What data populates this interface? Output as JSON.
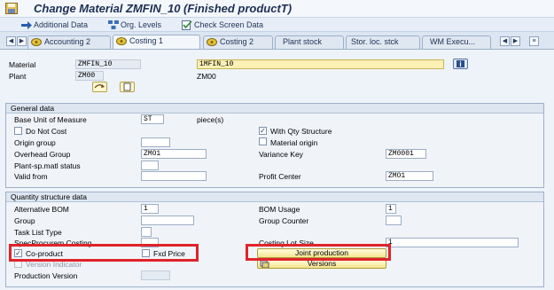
{
  "title": "Change Material ZMFIN_10 (Finished productT)",
  "toolbar": {
    "additional_data": "Additional Data",
    "org_levels": "Org. Levels",
    "check_screen_data": "Check Screen Data"
  },
  "tabs": [
    {
      "label": "Accounting 2"
    },
    {
      "label": "Costing 1"
    },
    {
      "label": "Costing 2"
    },
    {
      "label": "Plant stock"
    },
    {
      "label": "Stor. loc. stck"
    },
    {
      "label": "WM Execu..."
    }
  ],
  "header": {
    "material_label": "Material",
    "material_value": "ZMFIN_10",
    "material_desc": "1MFIN_10",
    "plant_label": "Plant",
    "plant_value": "ZM00",
    "plant_desc": "ZM00"
  },
  "general": {
    "title": "General data",
    "base_uom_label": "Base Unit of Measure",
    "base_uom_value": "ST",
    "base_uom_text": "piece(s)",
    "do_not_cost_label": "Do Not Cost",
    "with_qty_structure_label": "With Qty Structure",
    "origin_group_label": "Origin group",
    "material_origin_label": "Material origin",
    "overhead_group_label": "Overhead Group",
    "overhead_group_value": "ZMO1",
    "variance_key_label": "Variance Key",
    "variance_key_value": "ZM0001",
    "plant_sp_status_label": "Plant-sp.matl status",
    "valid_from_label": "Valid from",
    "profit_center_label": "Profit Center",
    "profit_center_value": "ZMO1"
  },
  "qty": {
    "title": "Quantity structure data",
    "alt_bom_label": "Alternative BOM",
    "alt_bom_value": "1",
    "bom_usage_label": "BOM Usage",
    "bom_usage_value": "1",
    "group_label": "Group",
    "group_counter_label": "Group Counter",
    "task_list_type_label": "Task List Type",
    "spec_procurem_label": "SpecProcurem Costing",
    "costing_lot_size_label": "Costing Lot Size",
    "costing_lot_size_value": "1",
    "co_product_label": "Co-product",
    "fxd_price_label": "Fxd Price",
    "joint_production_label": "Joint production",
    "version_indicator_label": "Version Indicator",
    "versions_label": "Versions",
    "production_version_label": "Production Version"
  },
  "colors": {
    "highlight": "#e0232b",
    "title": "#1d2f53",
    "background": "#dce6f2"
  }
}
